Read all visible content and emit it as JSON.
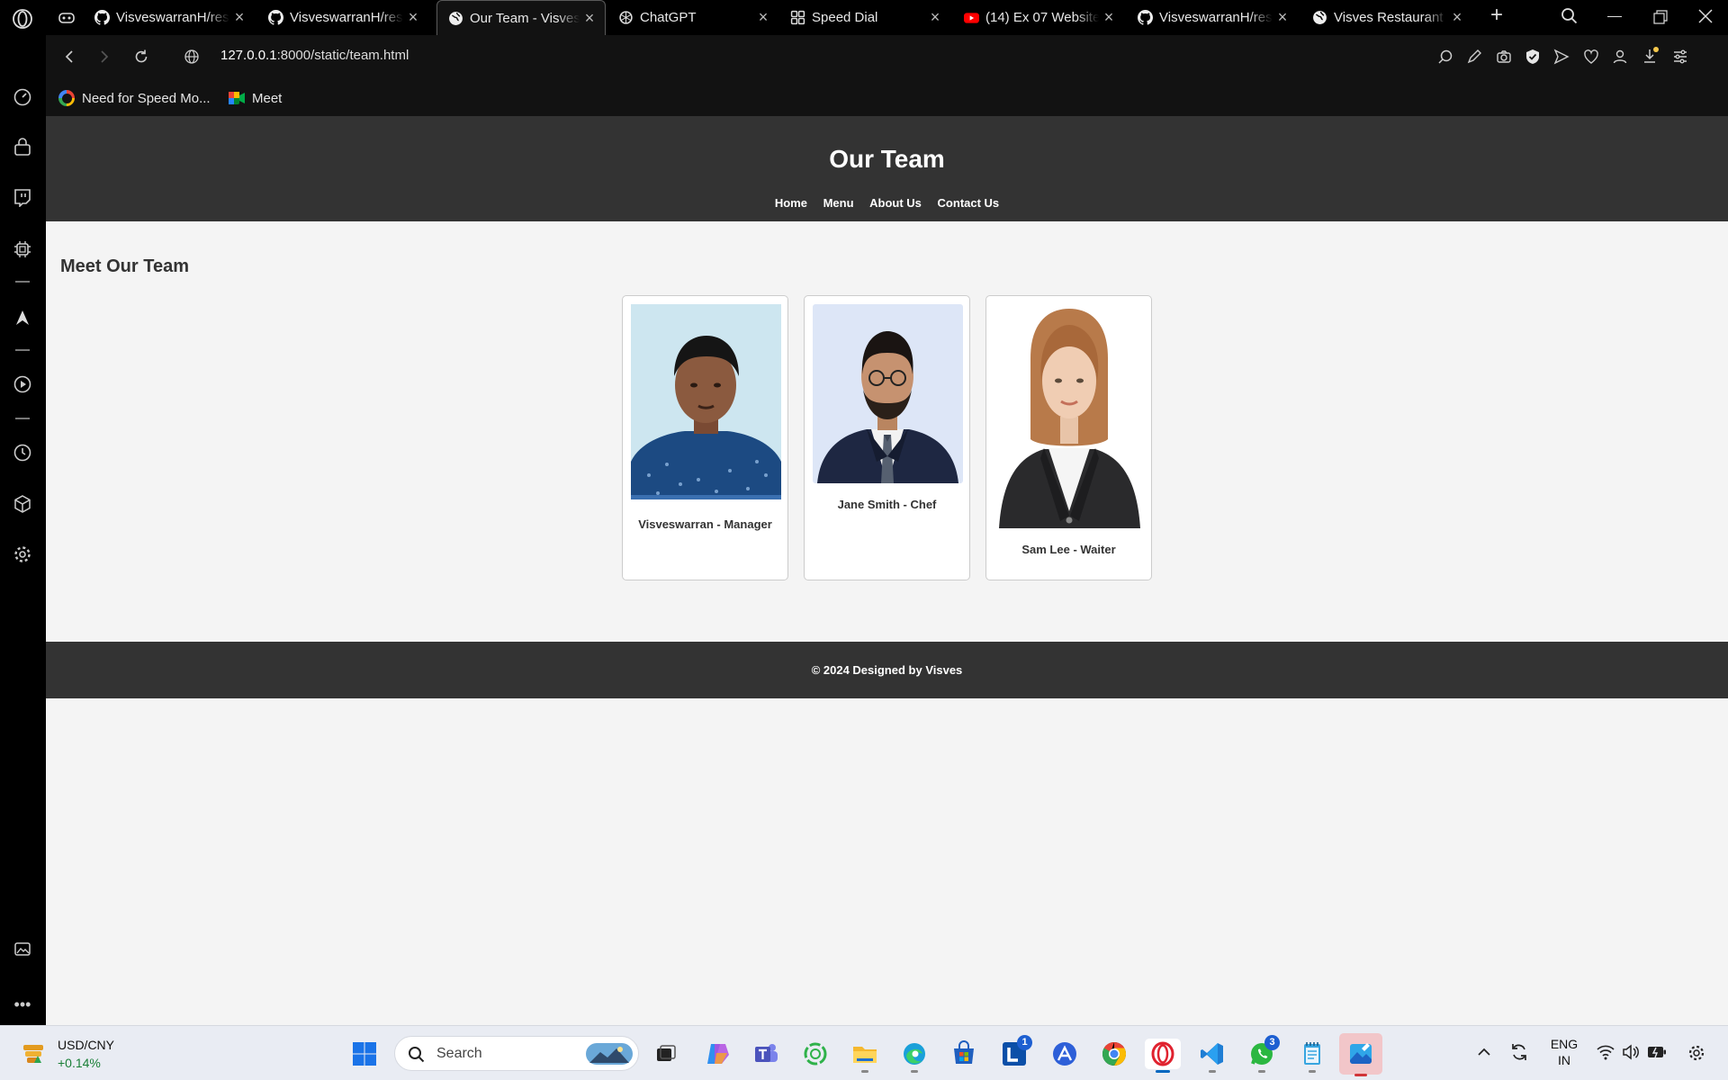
{
  "browser": {
    "tabs": [
      {
        "title": "VisveswarranH/restaurant",
        "favicon": "github-icon"
      },
      {
        "title": "VisveswarranH/restaurant",
        "favicon": "github-icon"
      },
      {
        "title": "Our Team - Visves Restaurant",
        "favicon": "globe-icon",
        "active": true
      },
      {
        "title": "ChatGPT",
        "favicon": "chatgpt-icon"
      },
      {
        "title": "Speed Dial",
        "favicon": "speed-dial-icon"
      },
      {
        "title": "(14) Ex 07 Website",
        "favicon": "youtube-icon"
      },
      {
        "title": "VisveswarranH/restaurant",
        "favicon": "github-icon"
      },
      {
        "title": "Visves Restaurant",
        "favicon": "globe-icon"
      }
    ],
    "address": {
      "host": "127.0.0.1",
      "path": ":8000/static/team.html"
    },
    "bookmarks": [
      {
        "label": "Need for Speed Mo...",
        "icon": "google-icon"
      },
      {
        "label": "Meet",
        "icon": "google-meet-icon"
      }
    ]
  },
  "site": {
    "title": "Our Team",
    "nav": [
      "Home",
      "Menu",
      "About Us",
      "Contact Us"
    ],
    "section_title": "Meet Our Team",
    "team": [
      {
        "caption": "Visveswarran - Manager"
      },
      {
        "caption": "Jane Smith - Chef"
      },
      {
        "caption": "Sam Lee - Waiter"
      }
    ],
    "footer": "© 2024 Designed by Visves"
  },
  "taskbar": {
    "widget": {
      "pair": "USD/CNY",
      "change": "+0.14%",
      "change_color": "#1a7f37"
    },
    "search_placeholder": "Search",
    "badges": {
      "linkedin": "1",
      "whatsapp": "3"
    },
    "lang": {
      "line1": "ENG",
      "line2": "IN"
    }
  },
  "colors": {
    "header_bg": "#333333",
    "page_bg": "#f4f4f4",
    "accent": "#0078d4"
  }
}
